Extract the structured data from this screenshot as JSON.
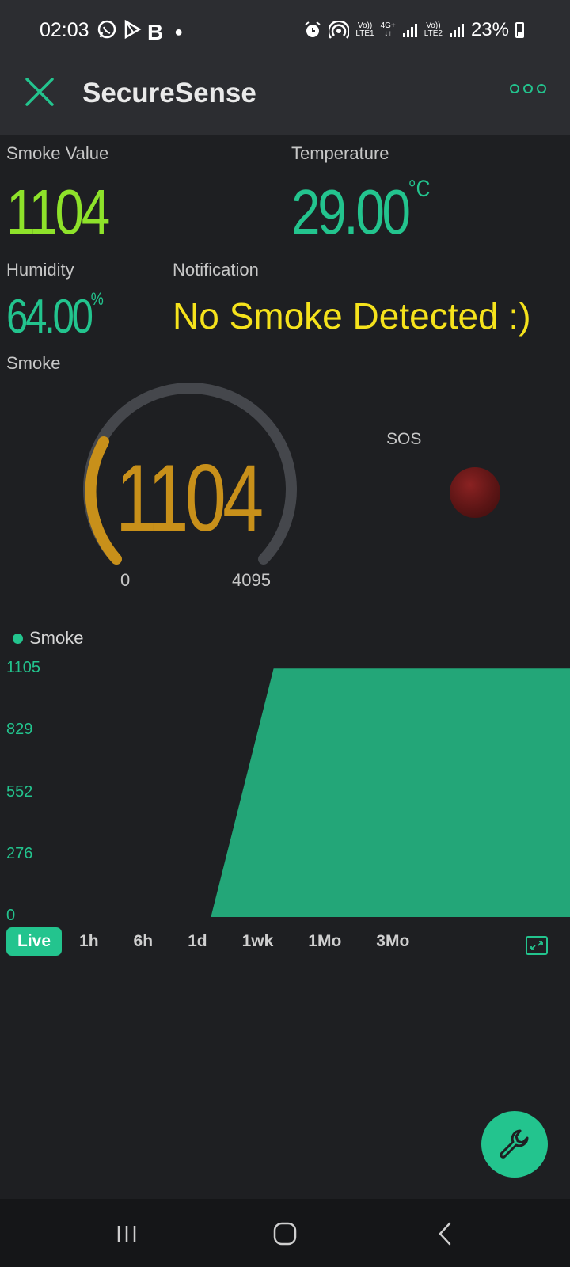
{
  "status_bar": {
    "time": "02:03",
    "left_icons": [
      "whatsapp-icon",
      "play-icon",
      "B"
    ],
    "battery": "23%",
    "network_1": "LTE1",
    "network_2": "LTE2",
    "network_type": "4G+"
  },
  "app": {
    "title": "SecureSense",
    "accent_color": "#23c48e"
  },
  "widgets": {
    "smoke_value": {
      "label": "Smoke Value",
      "value": "1104",
      "color": "#8ee22a"
    },
    "temperature": {
      "label": "Temperature",
      "value": "29.00",
      "unit": "°C",
      "color": "#23c48e"
    },
    "humidity": {
      "label": "Humidity",
      "value": "64.00",
      "unit": "%",
      "color": "#23c48e"
    },
    "notification": {
      "label": "Notification",
      "text": "No Smoke Detected :)",
      "color": "#f5e21c"
    },
    "gauge": {
      "label": "Smoke",
      "value": "1104",
      "min": "0",
      "max": "4095",
      "color": "#c8901a"
    },
    "sos": {
      "label": "SOS",
      "state": "off",
      "color": "#5c1515"
    }
  },
  "chart_data": {
    "type": "area",
    "series": [
      {
        "name": "Smoke",
        "color": "#23c48e"
      }
    ],
    "y_ticks": [
      "1105",
      "829",
      "552",
      "276",
      "0"
    ],
    "ylim": [
      0,
      1105
    ],
    "x": [
      0,
      0.37,
      0.48,
      1.0
    ],
    "values": [
      0,
      0,
      1104,
      1104
    ],
    "legend_position": "top-left"
  },
  "time_ranges": {
    "items": [
      "Live",
      "1h",
      "6h",
      "1d",
      "1wk",
      "1Mo",
      "3Mo"
    ],
    "active": "Live"
  }
}
